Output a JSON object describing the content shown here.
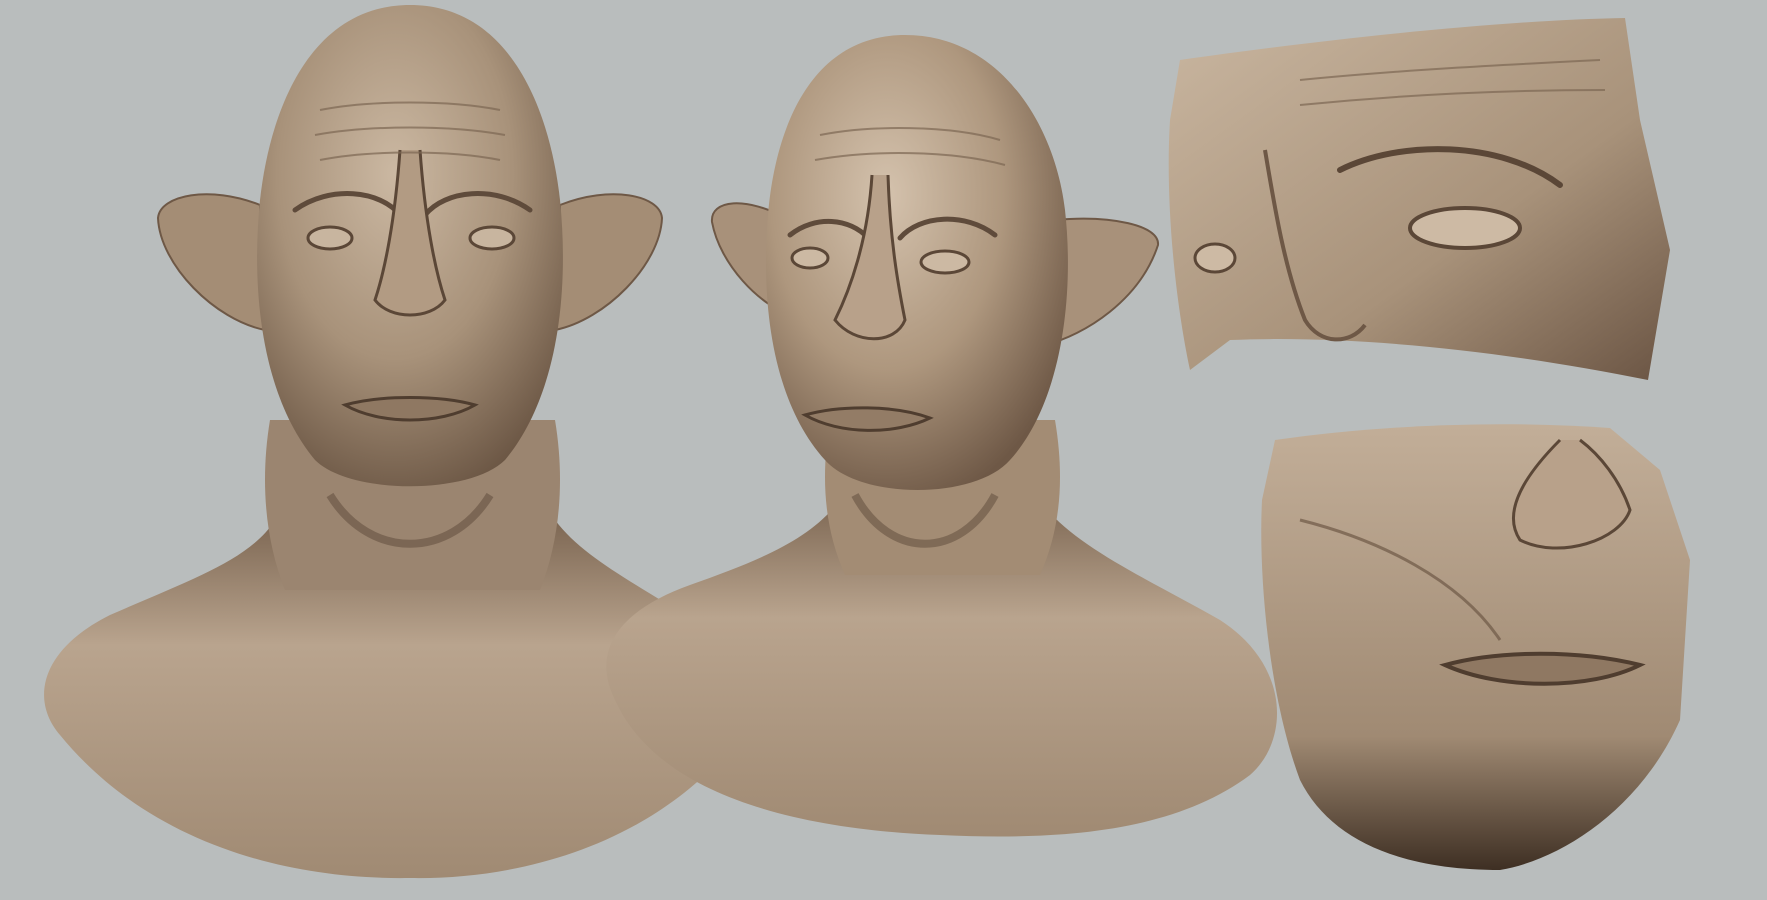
{
  "scene": {
    "background_color": "#b9bdbd",
    "material_color": "#a8927a",
    "highlight_color": "#d9c8b4",
    "shadow_color": "#4a3a2c",
    "subjects": [
      {
        "id": "bust-front",
        "description_name": "creature-bust-front-view"
      },
      {
        "id": "bust-three-quarter",
        "description_name": "creature-bust-three-quarter-view"
      },
      {
        "id": "detail-eyes",
        "description_name": "eye-region-detail"
      },
      {
        "id": "detail-mouth",
        "description_name": "nose-mouth-region-detail"
      }
    ]
  }
}
